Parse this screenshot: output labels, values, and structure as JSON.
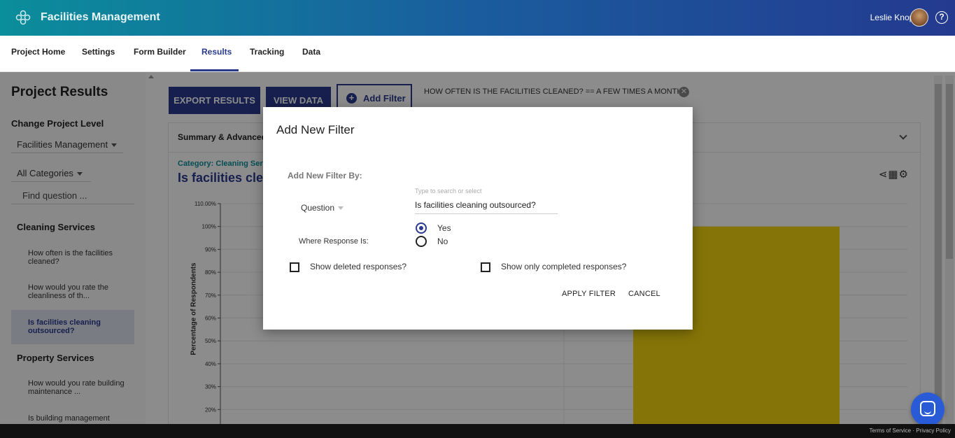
{
  "app": {
    "title": "Facilities Management",
    "user_name": "Leslie Knope",
    "help_glyph": "?"
  },
  "nav": {
    "tabs": [
      "Project Home",
      "Settings",
      "Form Builder",
      "Results",
      "Tracking",
      "Data"
    ],
    "active": "Results"
  },
  "sidebar": {
    "title": "Project Results",
    "change_level_label": "Change Project Level",
    "level_value": "Facilities Management",
    "categories_value": "All Categories",
    "find_placeholder": "Find question ...",
    "groups": [
      {
        "name": "Cleaning Services",
        "items": [
          "How often is the facilities cleaned?",
          "How would you rate the cleanliness of th...",
          "Is facilities cleaning outsourced?"
        ]
      },
      {
        "name": "Property Services",
        "items": [
          "How would you rate building maintenance ...",
          "Is building management"
        ]
      }
    ],
    "active_item": "Is facilities cleaning outsourced?"
  },
  "main": {
    "export_label": "EXPORT RESULTS",
    "view_data_label": "VIEW DATA",
    "add_filter_label": "Add Filter",
    "filter_chip": "HOW OFTEN IS THE FACILITIES CLEANED? == A FEW TIMES A MONTH",
    "summary_label": "Summary & Advanced",
    "category_label": "Category: Cleaning Serv",
    "question_title": "Is facilities clea",
    "tools": "share-icon table-icon gear-icon"
  },
  "chart_data": {
    "type": "bar",
    "ylabel": "Percentage of Respondents",
    "yticks": [
      "110.00%",
      "100%",
      "90%",
      "80%",
      "70%",
      "60%",
      "50%",
      "40%",
      "30%",
      "20%"
    ],
    "ylim": [
      20,
      110
    ],
    "values": [
      100
    ],
    "bar_color": "#f2d50f",
    "grid": true
  },
  "modal": {
    "title": "Add New Filter",
    "by_label": "Add New Filter By:",
    "type_label": "Question",
    "search_hint": "Type to search or select",
    "question_value": "Is facilities cleaning outsourced?",
    "where_label": "Where Response Is:",
    "options": [
      "Yes",
      "No"
    ],
    "selected_option": "Yes",
    "show_deleted_label": "Show deleted responses?",
    "show_completed_label": "Show only completed responses?",
    "apply_label": "APPLY FILTER",
    "cancel_label": "CANCEL"
  },
  "footer": {
    "terms": "Terms of Service",
    "privacy": "Privacy Policy"
  },
  "colors": {
    "primary": "#2a3a8f",
    "teal": "#0b8e9b",
    "bar": "#f2d50f"
  }
}
